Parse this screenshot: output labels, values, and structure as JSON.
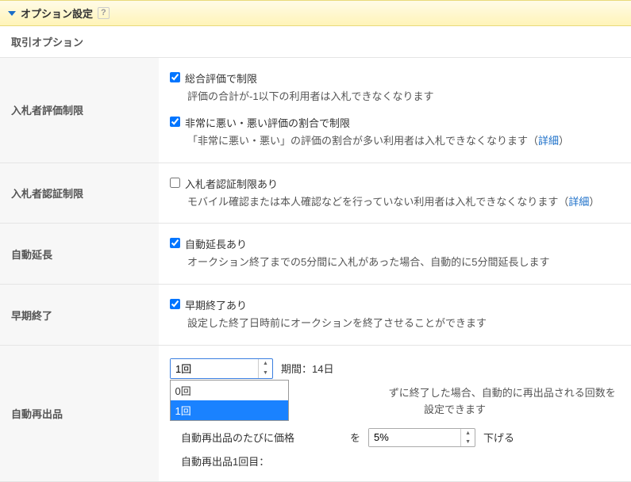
{
  "header": {
    "title": "オプション設定",
    "help_icon": "?"
  },
  "section_title": "取引オプション",
  "rows": {
    "bidder_rating": {
      "label": "入札者評価制限",
      "cb1_label": "総合評価で制限",
      "cb1_desc": "評価の合計が-1以下の利用者は入札できなくなります",
      "cb2_label": "非常に悪い・悪い評価の割合で制限",
      "cb2_desc_pre": "「非常に悪い・悪い」の評価の割合が多い利用者は入札できなくなります（",
      "cb2_detail": "詳細",
      "cb2_desc_post": "）"
    },
    "bidder_auth": {
      "label": "入札者認証制限",
      "cb_label": "入札者認証制限あり",
      "desc_pre": "モバイル確認または本人確認などを行っていない利用者は入札できなくなります（",
      "detail": "詳細",
      "desc_post": "）"
    },
    "auto_extend": {
      "label": "自動延長",
      "cb_label": "自動延長あり",
      "desc": "オークション終了までの5分間に入札があった場合、自動的に5分間延長します"
    },
    "early_end": {
      "label": "早期終了",
      "cb_label": "早期終了あり",
      "desc": "設定した終了日時前にオークションを終了させることができます"
    },
    "auto_relist": {
      "label": "自動再出品",
      "count_value": "1回",
      "dropdown_options": [
        "0回",
        "1回"
      ],
      "dropdown_selected_index": 1,
      "period_label": "期間：14日",
      "desc_tail": "ずに終了した場合、自動的に再出品される回数を設定できます",
      "price_row_pre": "自動再出品のたびに価格",
      "price_row_mid": "を",
      "pct_value": "5%",
      "price_row_post": "下げる",
      "first_time_label": "自動再出品1回目："
    }
  }
}
